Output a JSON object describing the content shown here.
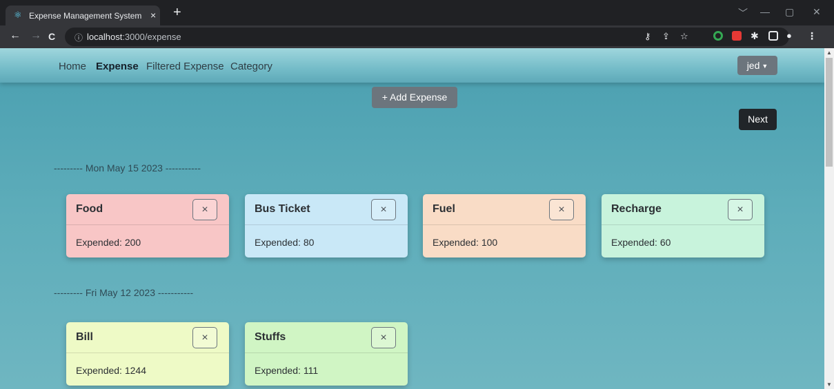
{
  "browser": {
    "tab_title": "Expense Management System",
    "tab_close": "×",
    "new_tab": "+",
    "url_host": "localhost",
    "url_path": ":3000/expense",
    "window_controls": [
      "﹀",
      "—",
      "▢",
      "✕"
    ]
  },
  "nav": {
    "links": [
      "Home",
      "Expense",
      "Filtered Expense",
      "Category"
    ],
    "active": "Expense",
    "user_label": "jed"
  },
  "actions": {
    "add_label": "+ Add Expense",
    "next_label": "Next"
  },
  "groups": [
    {
      "date_label": "--------- Mon May 15 2023 -----------",
      "items": [
        {
          "name": "Food",
          "amount_label": "Expended: 200",
          "color": "#f8c6c6"
        },
        {
          "name": "Bus Ticket",
          "amount_label": "Expended: 80",
          "color": "#c9e8f7"
        },
        {
          "name": "Fuel",
          "amount_label": "Expended: 100",
          "color": "#f9dcc6"
        },
        {
          "name": "Recharge",
          "amount_label": "Expended: 60",
          "color": "#c8f3dc"
        }
      ]
    },
    {
      "date_label": "--------- Fri May 12 2023 -----------",
      "items": [
        {
          "name": "Bill",
          "amount_label": "Expended: 1244",
          "color": "#eefac6"
        },
        {
          "name": "Stuffs",
          "amount_label": "Expended: 111",
          "color": "#d0f5c4"
        }
      ]
    }
  ],
  "delete_glyph": "×"
}
